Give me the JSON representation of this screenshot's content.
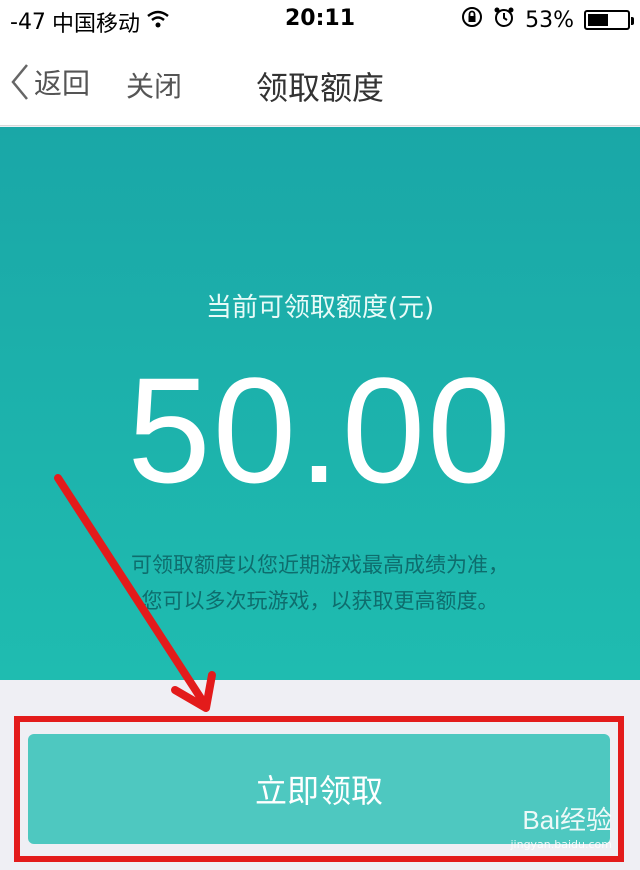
{
  "status_bar": {
    "signal": "-47",
    "carrier": "中国移动",
    "time": "20:11",
    "battery_percent": "53%",
    "battery_level": 0.53,
    "icons": [
      "wifi-icon",
      "rotation-lock-icon",
      "alarm-icon",
      "battery-icon"
    ]
  },
  "nav": {
    "back_label": "返回",
    "close_label": "关闭",
    "title": "领取额度"
  },
  "hero": {
    "label": "当前可领取额度(元)",
    "amount": "50.00",
    "note_line1": "可领取额度以您近期游戏最高成绩为准，",
    "note_line2": "您可以多次玩游戏，以获取更高额度。"
  },
  "actions": {
    "claim_label": "立即领取"
  },
  "watermark": {
    "brand": "Bai经验",
    "url": "jingyan.baidu.com"
  },
  "colors": {
    "hero_start": "#1aa7a7",
    "hero_end": "#1fbcb0",
    "button": "#4ec8c0",
    "highlight": "#e31b1b"
  }
}
